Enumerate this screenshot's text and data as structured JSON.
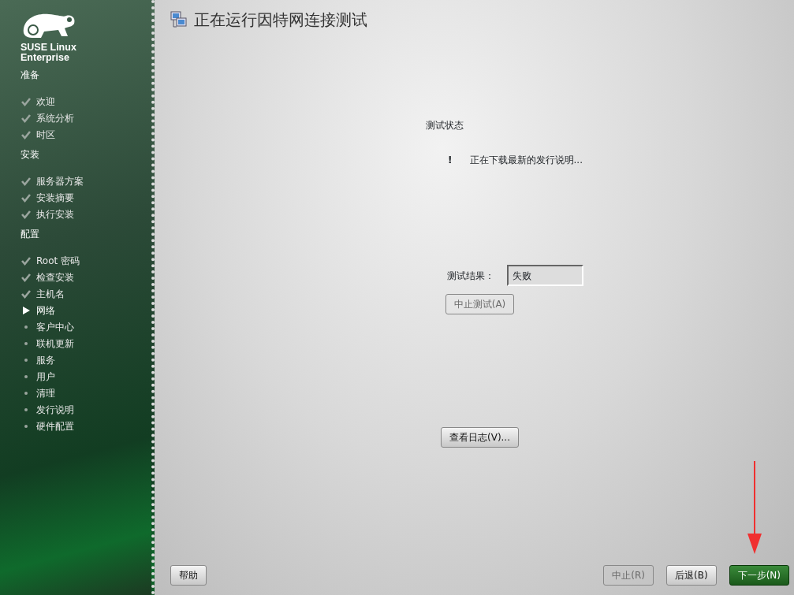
{
  "sidebar": {
    "logo_text": [
      "SUSE",
      "Linux",
      "Enterprise"
    ],
    "sections": [
      {
        "title": "准备",
        "items": [
          {
            "label": "欢迎",
            "done": true,
            "current": false
          },
          {
            "label": "系统分析",
            "done": true,
            "current": false
          },
          {
            "label": "时区",
            "done": true,
            "current": false
          }
        ]
      },
      {
        "title": "安装",
        "items": [
          {
            "label": "服务器方案",
            "done": true,
            "current": false
          },
          {
            "label": "安装摘要",
            "done": true,
            "current": false
          },
          {
            "label": "执行安装",
            "done": true,
            "current": false
          }
        ]
      },
      {
        "title": "配置",
        "items": [
          {
            "label": "Root 密码",
            "done": true,
            "current": false
          },
          {
            "label": "检查安装",
            "done": true,
            "current": false
          },
          {
            "label": "主机名",
            "done": true,
            "current": false
          },
          {
            "label": "网络",
            "current": true
          },
          {
            "label": "客户中心",
            "done": false,
            "current": false
          },
          {
            "label": "联机更新",
            "done": false,
            "current": false
          },
          {
            "label": "服务",
            "done": false,
            "current": false
          },
          {
            "label": "用户",
            "done": false,
            "current": false
          },
          {
            "label": "清理",
            "done": false,
            "current": false
          },
          {
            "label": "发行说明",
            "done": false,
            "current": false
          },
          {
            "label": "硬件配置",
            "done": false,
            "current": false
          }
        ]
      }
    ]
  },
  "page": {
    "title": "正在运行因特网连接测试",
    "status_heading": "测试状态",
    "status_mark": "!",
    "status_message": "正在下载最新的发行说明...",
    "result_label": "测试结果：",
    "result_value": "失败",
    "abort_test_button": {
      "label": "中止测试(A)",
      "disabled": true
    },
    "view_log_button": {
      "label": "查看日志(V)...",
      "disabled": false
    }
  },
  "footer": {
    "help": {
      "label": "帮助",
      "disabled": false
    },
    "abort": {
      "label": "中止(R)",
      "disabled": true
    },
    "back": {
      "label": "后退(B)",
      "disabled": false
    },
    "next": {
      "label": "下一步(N)",
      "disabled": false
    }
  }
}
